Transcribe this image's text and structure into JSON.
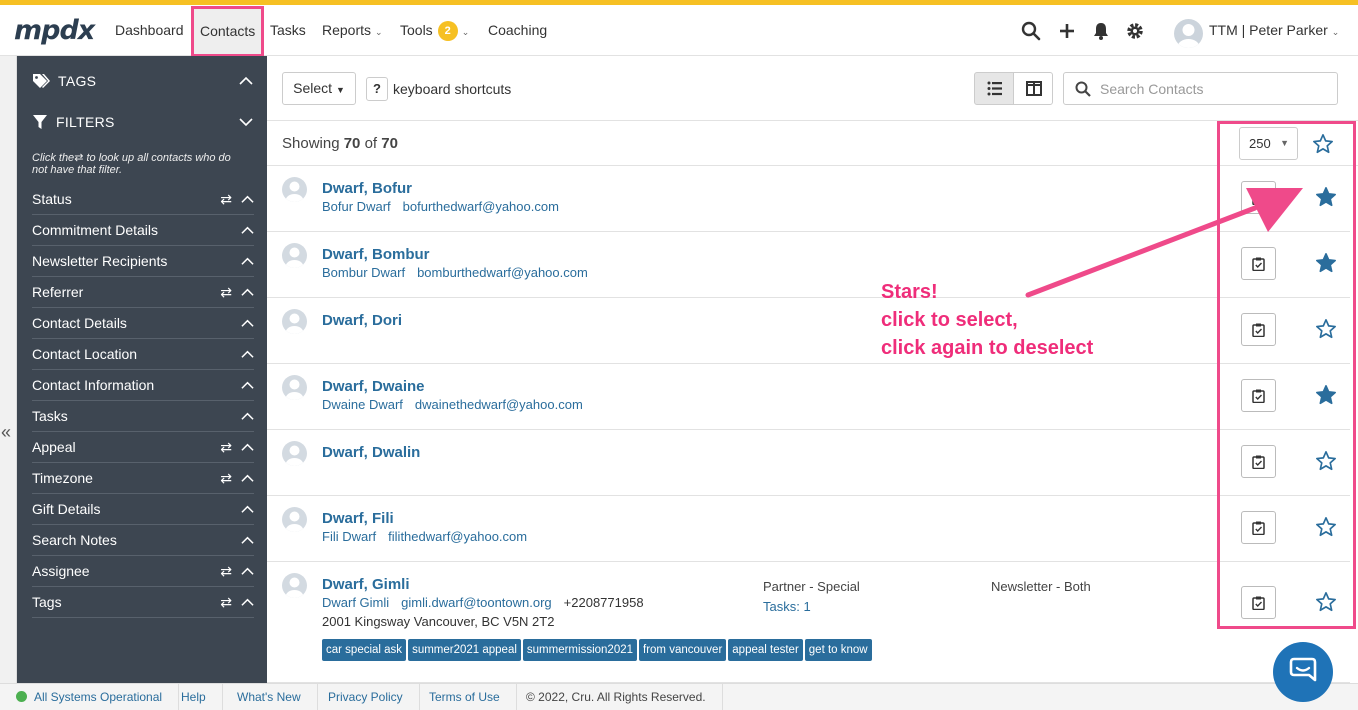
{
  "header": {
    "logo": "mpdx",
    "nav": [
      {
        "label": "Dashboard"
      },
      {
        "label": "Contacts"
      },
      {
        "label": "Tasks"
      },
      {
        "label": "Reports"
      },
      {
        "label": "Tools"
      },
      {
        "label": "Coaching"
      }
    ],
    "tools_badge": "2",
    "user": "TTM | Peter Parker"
  },
  "sidebar": {
    "tags_label": "TAGS",
    "filters_label": "FILTERS",
    "hint_pre": "Click the",
    "hint_post": "to look up all contacts who do not have that filter.",
    "filters": [
      {
        "label": "Status",
        "swap": true
      },
      {
        "label": "Commitment Details",
        "swap": false
      },
      {
        "label": "Newsletter Recipients",
        "swap": false
      },
      {
        "label": "Referrer",
        "swap": true
      },
      {
        "label": "Contact Details",
        "swap": false
      },
      {
        "label": "Contact Location",
        "swap": false
      },
      {
        "label": "Contact Information",
        "swap": false
      },
      {
        "label": "Tasks",
        "swap": false
      },
      {
        "label": "Appeal",
        "swap": true
      },
      {
        "label": "Timezone",
        "swap": true
      },
      {
        "label": "Gift Details",
        "swap": false
      },
      {
        "label": "Search Notes",
        "swap": false
      },
      {
        "label": "Assignee",
        "swap": true
      },
      {
        "label": "Tags",
        "swap": true
      }
    ]
  },
  "toolbar": {
    "select_label": "Select",
    "help_mark": "?",
    "shortcuts_label": "keyboard shortcuts",
    "search_placeholder": "Search Contacts"
  },
  "listing": {
    "showing_pre": "Showing",
    "shown": "70",
    "of": "of",
    "total": "70",
    "per_page": "250"
  },
  "contacts": [
    {
      "name": "Dwarf, Bofur",
      "person": "Bofur Dwarf",
      "email": "bofurthedwarf@yahoo.com",
      "starred": true
    },
    {
      "name": "Dwarf, Bombur",
      "person": "Bombur Dwarf",
      "email": "bomburthedwarf@yahoo.com",
      "starred": true
    },
    {
      "name": "Dwarf, Dori",
      "person": "",
      "email": "",
      "starred": false
    },
    {
      "name": "Dwarf, Dwaine",
      "person": "Dwaine Dwarf",
      "email": "dwainethedwarf@yahoo.com",
      "starred": true
    },
    {
      "name": "Dwarf, Dwalin",
      "person": "",
      "email": "",
      "starred": false
    },
    {
      "name": "Dwarf, Fili",
      "person": "Fili Dwarf",
      "email": "filithedwarf@yahoo.com",
      "starred": false
    },
    {
      "name": "Dwarf, Gimli",
      "person": "Dwarf Gimli",
      "email": "gimli.dwarf@toontown.org",
      "phone": "+2208771958",
      "address": "2001 Kingsway Vancouver, BC V5N 2T2",
      "status": "Partner - Special",
      "tasks": "Tasks: 1",
      "newsletter": "Newsletter - Both",
      "tags": [
        "car special ask",
        "summer2021 appeal",
        "summermission2021",
        "from vancouver",
        "appeal tester",
        "get to know"
      ],
      "starred": false
    }
  ],
  "annotation": {
    "line1": "Stars!",
    "line2": "click to select,",
    "line3": "click again to deselect"
  },
  "footer": {
    "status": "All Systems Operational",
    "help": "Help",
    "whats_new": "What's New",
    "privacy": "Privacy Policy",
    "terms": "Terms of Use",
    "copyright": "© 2022, Cru. All Rights Reserved."
  },
  "colors": {
    "accent_yellow": "#f6c023",
    "link_blue": "#2a6d9c",
    "sidebar_bg": "#3d4651",
    "annotation_pink": "#ef4a8a",
    "star_blue": "#2a6d9c"
  }
}
